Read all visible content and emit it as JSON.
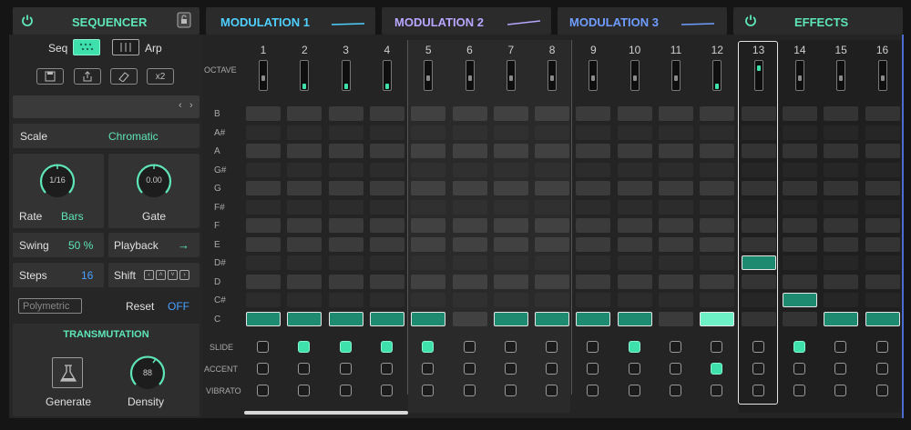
{
  "tabs": [
    {
      "label": "SEQUENCER",
      "color": "#5ee6b6"
    },
    {
      "label": "MODULATION 1",
      "color": "#4fd0ff"
    },
    {
      "label": "MODULATION 2",
      "color": "#b9a6ff"
    },
    {
      "label": "MODULATION 3",
      "color": "#6f9dff"
    },
    {
      "label": "EFFECTS",
      "color": "#5ee6b6"
    }
  ],
  "mode": {
    "seq": "Seq",
    "arp": "Arp",
    "x2": "x2"
  },
  "scale": {
    "label": "Scale",
    "value": "Chromatic"
  },
  "rate": {
    "label": "Rate",
    "unit": "Bars",
    "knob": "1/16"
  },
  "gate": {
    "label": "Gate",
    "knob": "0.00"
  },
  "swing": {
    "label": "Swing",
    "value": "50 %"
  },
  "playback": {
    "label": "Playback",
    "value": "→"
  },
  "steps": {
    "label": "Steps",
    "value": "16"
  },
  "shift": {
    "label": "Shift"
  },
  "polymetric": {
    "label": "Polymetric"
  },
  "reset": {
    "label": "Reset",
    "value": "OFF"
  },
  "transmutation": {
    "title": "TRANSMUTATION",
    "generate": "Generate",
    "density": "Density",
    "density_value": "88"
  },
  "grid": {
    "octave_label": "OCTAVE",
    "steps": [
      "1",
      "2",
      "3",
      "4",
      "5",
      "6",
      "7",
      "8",
      "9",
      "10",
      "11",
      "12",
      "13",
      "14",
      "15",
      "16"
    ],
    "notes": [
      "B",
      "A#",
      "A",
      "G#",
      "G",
      "F#",
      "F",
      "E",
      "D#",
      "D",
      "C#",
      "C"
    ],
    "active_notes": [
      "C",
      "C",
      "C",
      "C",
      "C",
      "",
      "C",
      "C",
      "C",
      "C",
      "",
      "C",
      "D#",
      "C#",
      "C",
      "C"
    ],
    "octave": [
      "mid",
      "low",
      "low",
      "low",
      "mid",
      "mid",
      "mid",
      "mid",
      "mid",
      "mid",
      "mid",
      "low",
      "high",
      "mid",
      "mid",
      "mid"
    ],
    "current_step": "13",
    "slide": [
      false,
      true,
      true,
      true,
      true,
      false,
      false,
      false,
      false,
      true,
      false,
      false,
      false,
      true,
      false,
      false
    ],
    "accent": [
      false,
      false,
      false,
      false,
      false,
      false,
      false,
      false,
      false,
      false,
      false,
      true,
      false,
      false,
      false,
      false
    ],
    "vibrato": [
      false,
      false,
      false,
      false,
      false,
      false,
      false,
      false,
      false,
      false,
      false,
      false,
      false,
      false,
      false,
      false
    ],
    "slide_label": "SLIDE",
    "accent_label": "ACCENT",
    "vibrato_label": "VIBRATO"
  }
}
